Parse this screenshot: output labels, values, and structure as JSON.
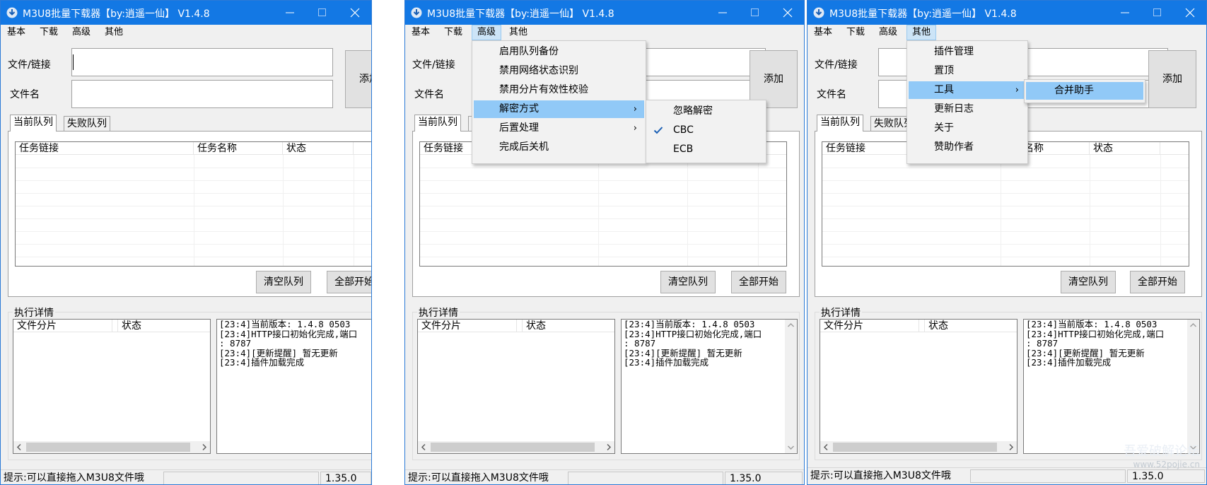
{
  "app": {
    "title": "M3U8批量下载器【by:逍遥一仙】 V1.4.8",
    "menu": [
      "基本",
      "下载",
      "高级",
      "其他"
    ]
  },
  "form": {
    "file_link_label": "文件/链接",
    "filename_label": "文件名",
    "file_link_value": "",
    "filename_value": "",
    "add_button": "添加"
  },
  "tabs": [
    "当前队列",
    "失败队列"
  ],
  "tabs_clipped": [
    "当前队列",
    "失",
    "失败队列"
  ],
  "task_list": {
    "columns": [
      "任务链接",
      "任务名称",
      "状态"
    ]
  },
  "buttons": {
    "clear_queue": "清空队列",
    "start_all": "全部开始"
  },
  "details": {
    "group_label": "执行详情",
    "columns": [
      "文件分片",
      "状态"
    ],
    "log": [
      "[23:4]当前版本: 1.4.8 0503",
      "[23:4]HTTP接口初始化完成,端口",
      ": 8787",
      "[23:4][更新提醒] 暂无更新",
      "[23:4]插件加载完成"
    ]
  },
  "statusbar": {
    "hint": "提示:可以直接拖入M3U8文件哦",
    "version": "1.35.0"
  },
  "menus": {
    "advanced": {
      "items": [
        "启用队列备份",
        "禁用网络状态识别",
        "禁用分片有效性校验",
        "解密方式",
        "后置处理",
        "完成后关机"
      ],
      "decrypt_submenu": [
        "忽略解密",
        "CBC",
        "ECB"
      ],
      "checked": "CBC"
    },
    "other": {
      "items": [
        "插件管理",
        "置顶",
        "工具",
        "更新日志",
        "关于",
        "赞助作者"
      ],
      "tools_submenu": [
        "合并助手"
      ]
    }
  },
  "watermark": {
    "line1": "吾爱破解论坛",
    "line2": "www.52pojie.cn"
  },
  "colors": {
    "titlebar": "#1378e4",
    "menu_highlight": "#91c9f7",
    "window_bg": "#f0f0f0"
  }
}
